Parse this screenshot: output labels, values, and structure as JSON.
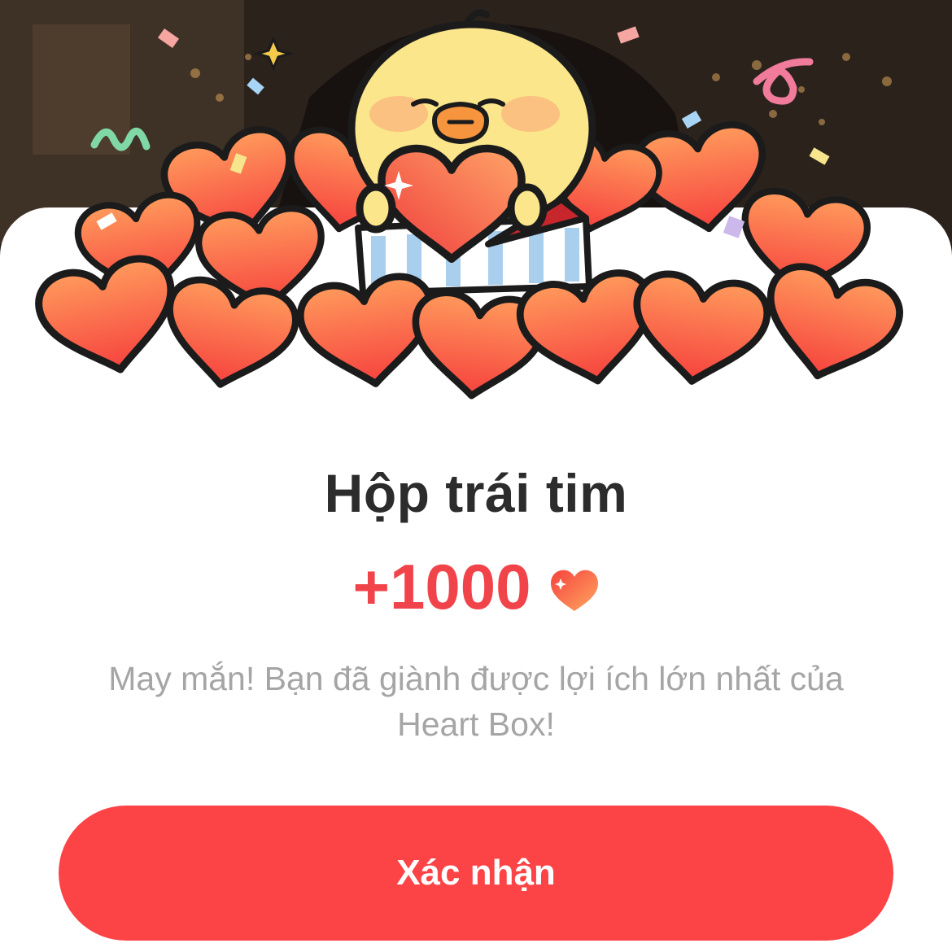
{
  "dialog": {
    "title": "Hộp trái tim",
    "reward_amount": "+1000",
    "reward_icon": "heart-icon",
    "message": "May mắn! Bạn đã giành được lợi ích lớn nhất của Heart Box!",
    "confirm_label": "Xác nhận"
  },
  "colors": {
    "accent": "#fc4447",
    "reward_text": "#f1444a",
    "title_text": "#2c2c2c",
    "message_text": "#a5a5a5",
    "heart_fill_top": "#ff9a5c",
    "heart_fill_bottom": "#f6423e",
    "mascot_yellow": "#fbe68c"
  }
}
